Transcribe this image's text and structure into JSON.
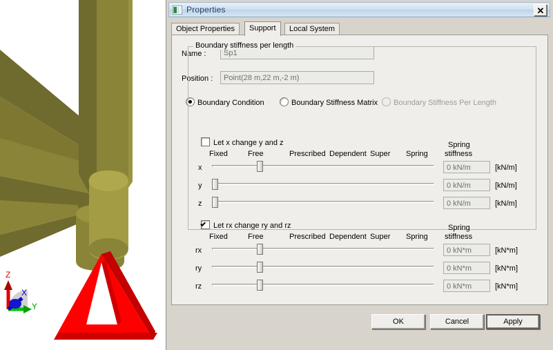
{
  "viewport": {
    "name": "3d-model-viewport",
    "axis_triad": {
      "z_label": "Z",
      "y_label": "Y",
      "x_label": "X"
    },
    "colors": {
      "beam": "#8a8438",
      "beam_shade": "#6f6a2d",
      "support_symbol": "#ff0000",
      "axis_z": "#e00000",
      "axis_y": "#00c000",
      "axis_x": "#0000c8",
      "background": "#ffffff"
    }
  },
  "window": {
    "title": "Properties",
    "icon": "window-properties-icon",
    "close_label": "✕"
  },
  "tabs": [
    {
      "label": "Object Properties",
      "active": false
    },
    {
      "label": "Support",
      "active": true
    },
    {
      "label": "Local System",
      "active": false
    }
  ],
  "fields": {
    "name_label": "Name :",
    "name_value": "Sp1",
    "position_label": "Position :",
    "position_value": "Point(28 m,22 m,-2 m)"
  },
  "mode_radios": [
    {
      "label": "Boundary Condition",
      "checked": true,
      "disabled": false
    },
    {
      "label": "Boundary Stiffness Matrix",
      "checked": false,
      "disabled": false
    },
    {
      "label": "Boundary Stiffness Per Length",
      "checked": false,
      "disabled": true
    }
  ],
  "groupbox": {
    "label": "Boundary stiffness per length"
  },
  "translation": {
    "checkbox_label": "Let x change y and z",
    "checkbox_checked": false,
    "columns": [
      "Fixed",
      "Free",
      "Prescribed",
      "Dependent",
      "Super",
      "Spring"
    ],
    "stiffness_header_line1": "Spring",
    "stiffness_header_line2": "stiffness",
    "rows": [
      {
        "axis": "x",
        "slider_value": "Free",
        "stiffness_value": "0 kN/m",
        "unit": "[kN/m]"
      },
      {
        "axis": "y",
        "slider_value": "Fixed",
        "stiffness_value": "0 kN/m",
        "unit": "[kN/m]"
      },
      {
        "axis": "z",
        "slider_value": "Fixed",
        "stiffness_value": "0 kN/m",
        "unit": "[kN/m]"
      }
    ]
  },
  "rotation": {
    "checkbox_label": "Let rx change ry and rz",
    "checkbox_checked": true,
    "columns": [
      "Fixed",
      "Free",
      "Prescribed",
      "Dependent",
      "Super",
      "Spring"
    ],
    "stiffness_header_line1": "Spring",
    "stiffness_header_line2": "stiffness",
    "hint_icon": "lightbulb-help-icon",
    "rows": [
      {
        "axis": "rx",
        "slider_value": "Free",
        "stiffness_value": "0 kN*m",
        "unit": "[kN*m]"
      },
      {
        "axis": "ry",
        "slider_value": "Free",
        "stiffness_value": "0 kN*m",
        "unit": "[kN*m]"
      },
      {
        "axis": "rz",
        "slider_value": "Free",
        "stiffness_value": "0 kN*m",
        "unit": "[kN*m]"
      }
    ]
  },
  "buttons": {
    "ok": "OK",
    "cancel": "Cancel",
    "apply": "Apply"
  }
}
